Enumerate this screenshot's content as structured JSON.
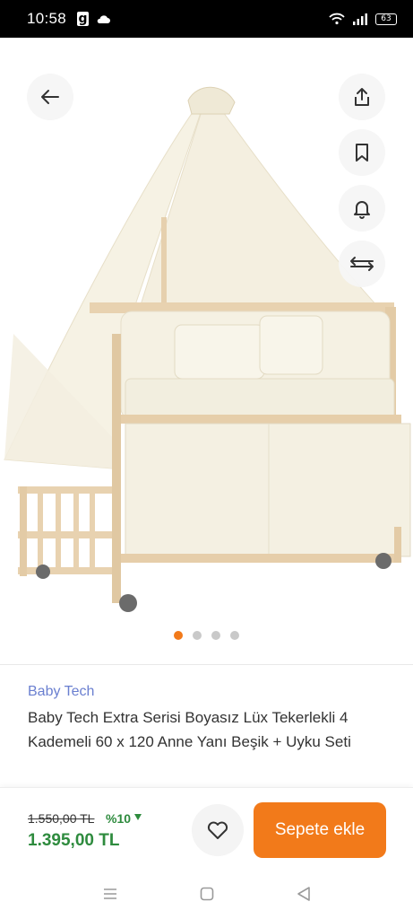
{
  "status_bar": {
    "time": "10:58",
    "app_icon": "g",
    "battery": "63",
    "icons": [
      "cloud-icon",
      "wifi-icon",
      "signal-icon",
      "battery-icon"
    ]
  },
  "gallery": {
    "actions": [
      "back-arrow-icon",
      "share-icon",
      "bookmark-icon",
      "bell-icon",
      "compare-icon"
    ],
    "dots_count": 4,
    "active_dot": 0,
    "accent_color": "#f27a1a"
  },
  "product": {
    "brand": "Baby Tech",
    "title": "Baby Tech Extra Serisi Boyasız Lüx Tekerlekli 4 Kademeli 60 x 120 Anne Yanı Beşik + Uyku Seti"
  },
  "price": {
    "old": "1.550,00 TL",
    "discount": "%10",
    "new": "1.395,00 TL",
    "price_color": "#2e8b3e"
  },
  "actions": {
    "favorite_icon": "heart-icon",
    "add_to_cart": "Sepete ekle"
  },
  "nav": [
    "menu-icon",
    "home-icon",
    "back-icon"
  ]
}
